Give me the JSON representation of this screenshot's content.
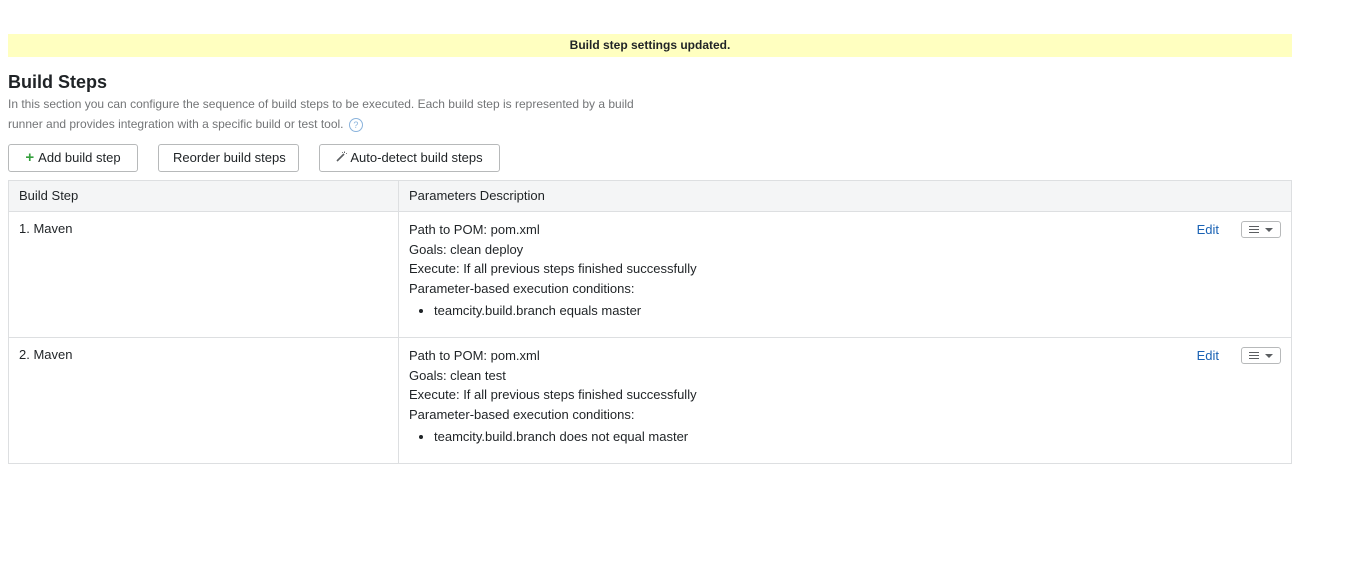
{
  "notice": {
    "text": "Build step settings updated."
  },
  "section": {
    "title": "Build Steps",
    "description": "In this section you can configure the sequence of build steps to be executed. Each build step is represented by a build runner and provides integration with a specific build or test tool.",
    "help_glyph": "?"
  },
  "toolbar": {
    "add_icon": "+",
    "add_label": "Add build step",
    "reorder_label": "Reorder build steps",
    "autodetect_icon": "magic-wand-icon",
    "autodetect_label": "Auto-detect build steps"
  },
  "table": {
    "headers": {
      "step": "Build Step",
      "params": "Parameters Description"
    },
    "rows": [
      {
        "step": "1. Maven",
        "path": "Path to POM: pom.xml",
        "goals": "Goals: clean deploy",
        "execute": "Execute: If all previous steps finished successfully",
        "conditions_label": "Parameter-based execution conditions:",
        "conditions": [
          "teamcity.build.branch equals master"
        ],
        "edit_label": "Edit"
      },
      {
        "step": "2. Maven",
        "path": "Path to POM: pom.xml",
        "goals": "Goals: clean test",
        "execute": "Execute: If all previous steps finished successfully",
        "conditions_label": "Parameter-based execution conditions:",
        "conditions": [
          "teamcity.build.branch does not equal master"
        ],
        "edit_label": "Edit"
      }
    ]
  },
  "colors": {
    "notice_bg": "#ffffc0",
    "link": "#1a62b4",
    "add_plus": "#35a03d"
  }
}
